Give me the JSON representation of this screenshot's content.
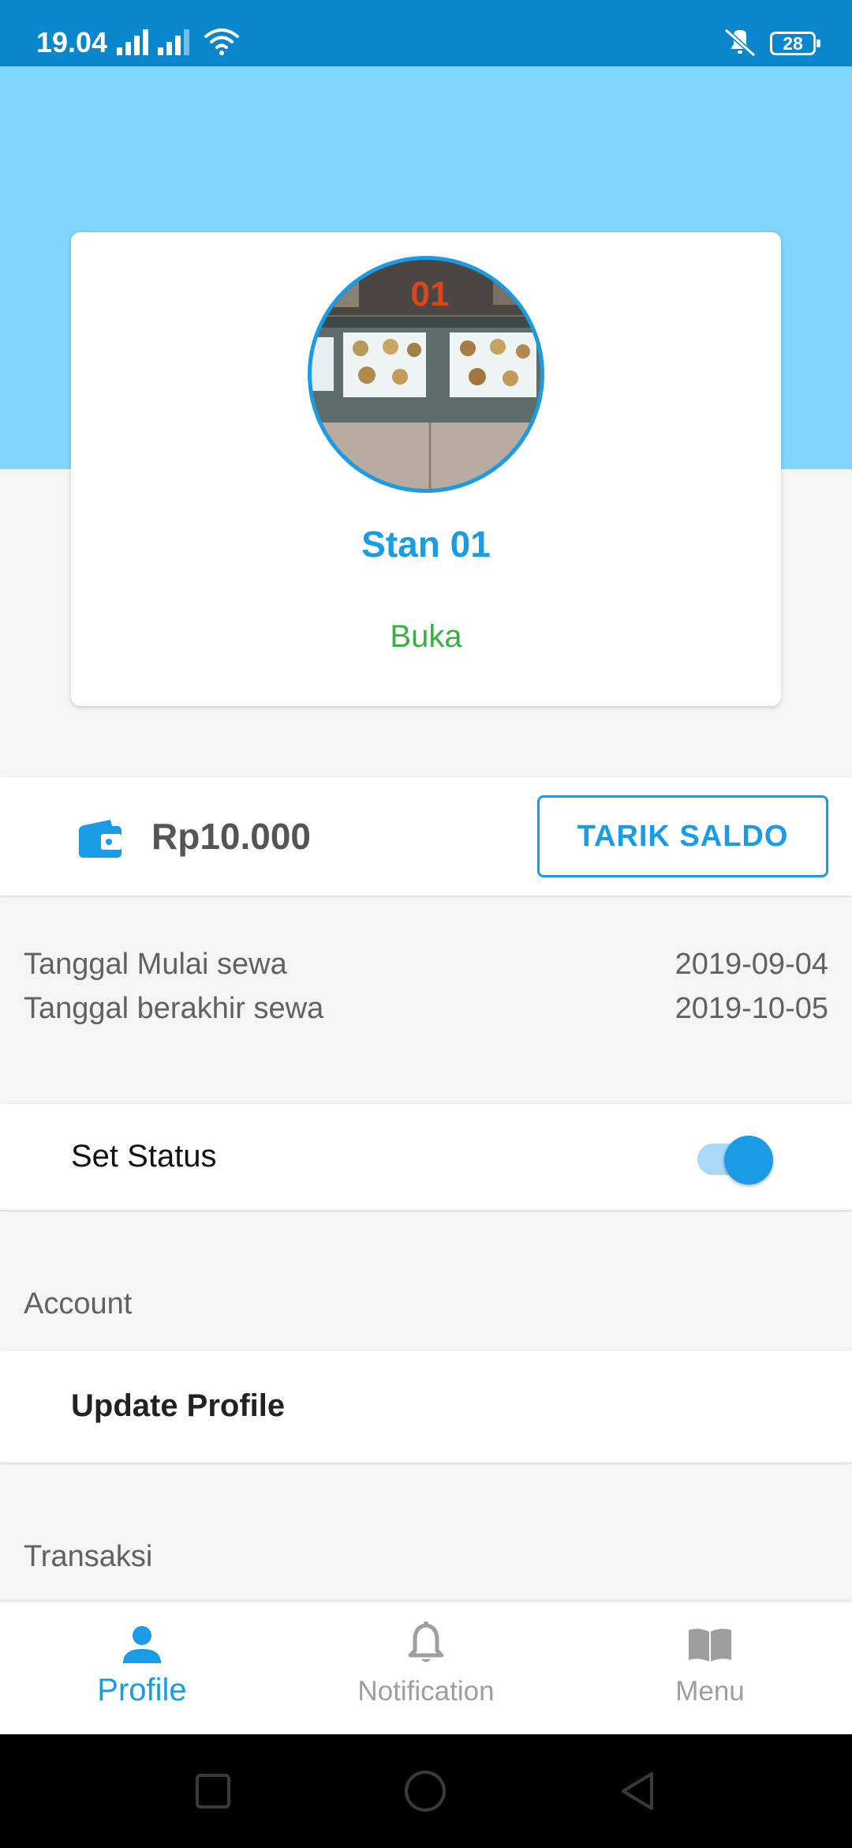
{
  "status_bar": {
    "time": "19.04",
    "battery": "28"
  },
  "profile": {
    "stall_name": "Stan 01",
    "status": "Buka",
    "photo_label": "01"
  },
  "balance": {
    "amount": "Rp10.000",
    "withdraw_label": "TARIK SALDO"
  },
  "rent": {
    "start_label": "Tanggal Mulai sewa",
    "start_date": "2019-09-04",
    "end_label": "Tanggal berakhir sewa",
    "end_date": "2019-10-05"
  },
  "set_status": {
    "label": "Set Status",
    "enabled": true
  },
  "sections": {
    "account": "Account",
    "transaksi": "Transaksi"
  },
  "account": {
    "update_profile": "Update Profile"
  },
  "bottom_nav": [
    {
      "label": "Profile",
      "icon": "person-icon",
      "active": true
    },
    {
      "label": "Notification",
      "icon": "bell-icon",
      "active": false
    },
    {
      "label": "Menu",
      "icon": "book-icon",
      "active": false
    }
  ],
  "colors": {
    "status_bar": "#0a86cd",
    "header": "#81d4fa",
    "accent": "#1a9be6",
    "open_status": "#3cae46"
  }
}
